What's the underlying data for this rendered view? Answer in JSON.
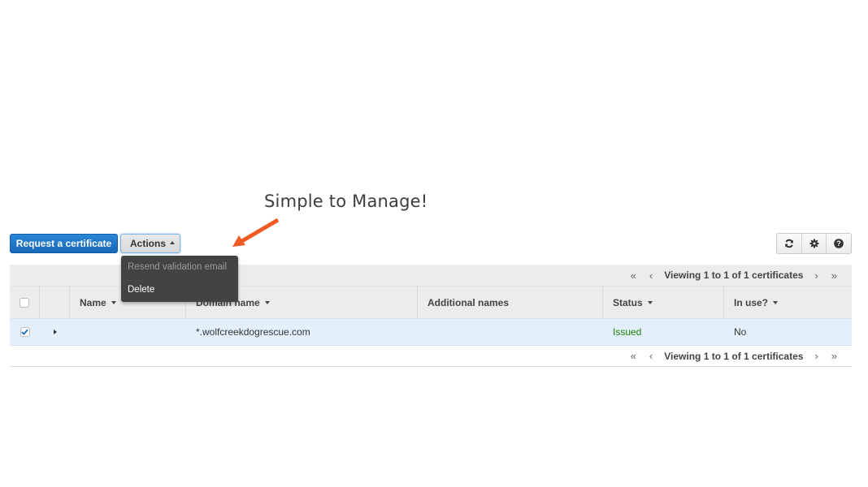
{
  "annotation": {
    "title": "Simple to Manage!",
    "arrow_color": "#f15a24"
  },
  "toolbar": {
    "request_label": "Request a certificate",
    "actions_label": "Actions",
    "icons": [
      "refresh-icon",
      "gear-icon",
      "help-icon"
    ]
  },
  "actions_menu": {
    "items": [
      {
        "label": "Resend validation email",
        "enabled": false
      },
      {
        "label": "Delete",
        "enabled": true
      }
    ]
  },
  "pager": {
    "first": "«",
    "prev": "‹",
    "text": "Viewing 1 to 1 of 1 certificates",
    "next": "›",
    "last": "»"
  },
  "table": {
    "columns": [
      {
        "key": "name",
        "label": "Name",
        "sortable": true
      },
      {
        "key": "domain",
        "label": "Domain name",
        "sortable": true
      },
      {
        "key": "additional",
        "label": "Additional names",
        "sortable": false
      },
      {
        "key": "status",
        "label": "Status",
        "sortable": true
      },
      {
        "key": "in_use",
        "label": "In use?",
        "sortable": true
      }
    ],
    "header_checked": false,
    "rows": [
      {
        "checked": true,
        "name": "",
        "domain": "*.wolfcreekdogrescue.com",
        "additional": "",
        "status": "Issued",
        "in_use": "No"
      }
    ]
  },
  "colors": {
    "primary": "#1f78c8",
    "status_issued": "#1d8102",
    "selected_row": "#e3f0fc"
  }
}
